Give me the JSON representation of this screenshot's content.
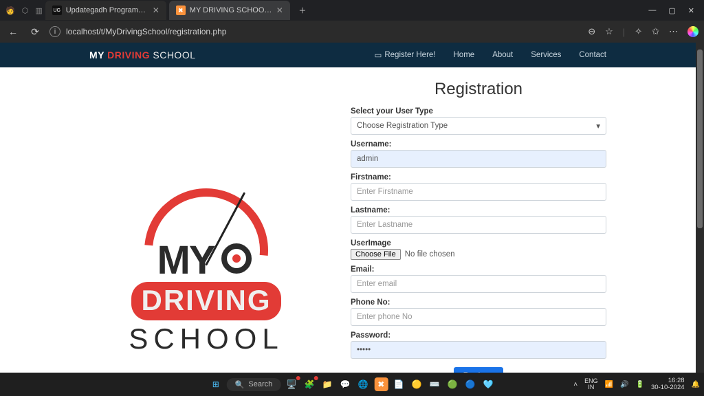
{
  "browser": {
    "tabs": [
      {
        "title": "Updategadh Programming - Upd",
        "favicon_bg": "#111",
        "favicon_text": "UG",
        "favicon_color": "#fff"
      },
      {
        "title": "MY DRIVING SCHOOL - Book You",
        "favicon_bg": "#fb923c",
        "favicon_text": "✖",
        "favicon_color": "#fff"
      }
    ],
    "active_tab_index": 1,
    "url": "localhost/t/MyDrivingSchool/registration.php",
    "win_controls": {
      "min": "—",
      "max": "▢",
      "close": "✕"
    }
  },
  "site": {
    "brand": {
      "b1": "MY",
      "b2": "DRIVING",
      "b3": "SCHOOL"
    },
    "nav": {
      "register_icon": "▭",
      "register": "Register Here!",
      "home": "Home",
      "about": "About",
      "services": "Services",
      "contact": "Contact"
    }
  },
  "logo": {
    "my": "MY",
    "driving": "DRIVING",
    "school": "SCHOOL"
  },
  "form": {
    "title": "Registration",
    "user_type": {
      "label": "Select your User Type",
      "placeholder": "Choose Registration Type"
    },
    "username": {
      "label": "Username:",
      "value": "admin"
    },
    "firstname": {
      "label": "Firstname:",
      "placeholder": "Enter Firstname"
    },
    "lastname": {
      "label": "Lastname:",
      "placeholder": "Enter Lastname"
    },
    "userimage": {
      "label": "UserImage",
      "button": "Choose File",
      "status": "No file chosen"
    },
    "email": {
      "label": "Email:",
      "placeholder": "Enter email"
    },
    "phone": {
      "label": "Phone No:",
      "placeholder": "Enter phone No"
    },
    "password": {
      "label": "Password:",
      "value": "•••••"
    },
    "submit": "Register"
  },
  "taskbar": {
    "search_placeholder": "Search",
    "lang": "ENG\nIN",
    "time": "16:28",
    "date": "30-10-2024"
  }
}
